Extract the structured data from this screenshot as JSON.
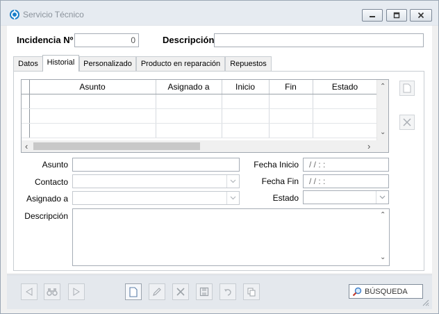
{
  "window": {
    "title": "Servicio Técnico"
  },
  "header": {
    "incidencia_label": "Incidencia Nº",
    "incidencia_value": "0",
    "descripcion_label": "Descripción",
    "descripcion_value": ""
  },
  "tabs": [
    {
      "label": "Datos"
    },
    {
      "label": "Historial"
    },
    {
      "label": "Personalizado"
    },
    {
      "label": "Producto en reparación"
    },
    {
      "label": "Repuestos"
    }
  ],
  "active_tab": "Historial",
  "grid": {
    "columns": [
      "Asunto",
      "Asignado a",
      "Inicio",
      "Fin",
      "Estado"
    ],
    "rows": [
      [
        "",
        "",
        "",
        "",
        ""
      ],
      [
        "",
        "",
        "",
        "",
        ""
      ],
      [
        "",
        "",
        "",
        "",
        ""
      ]
    ],
    "arrows": {
      "up": "⌃",
      "down": "⌄",
      "left": "‹",
      "right": "›"
    }
  },
  "form": {
    "asunto_label": "Asunto",
    "asunto_value": "",
    "contacto_label": "Contacto",
    "contacto_value": "",
    "asignado_label": "Asignado a",
    "asignado_value": "",
    "descripcion_label": "Descripción",
    "descripcion_value": "",
    "fecha_inicio_label": "Fecha Inicio",
    "fecha_inicio_value": " /  /        :  :",
    "fecha_fin_label": "Fecha Fin",
    "fecha_fin_value": " /  /        :  :",
    "estado_label": "Estado",
    "estado_value": ""
  },
  "toolbar": {
    "search_label": "BÚSQUEDA"
  },
  "icons": {
    "app": "gear-icon",
    "minimize": "minimize-icon",
    "maximize": "maximize-icon",
    "close": "close-icon"
  },
  "colors": {
    "title_text": "#8a929b",
    "toolbar_bg": "#e4e8ed",
    "titlebar_bg": "#e6ebf1"
  }
}
